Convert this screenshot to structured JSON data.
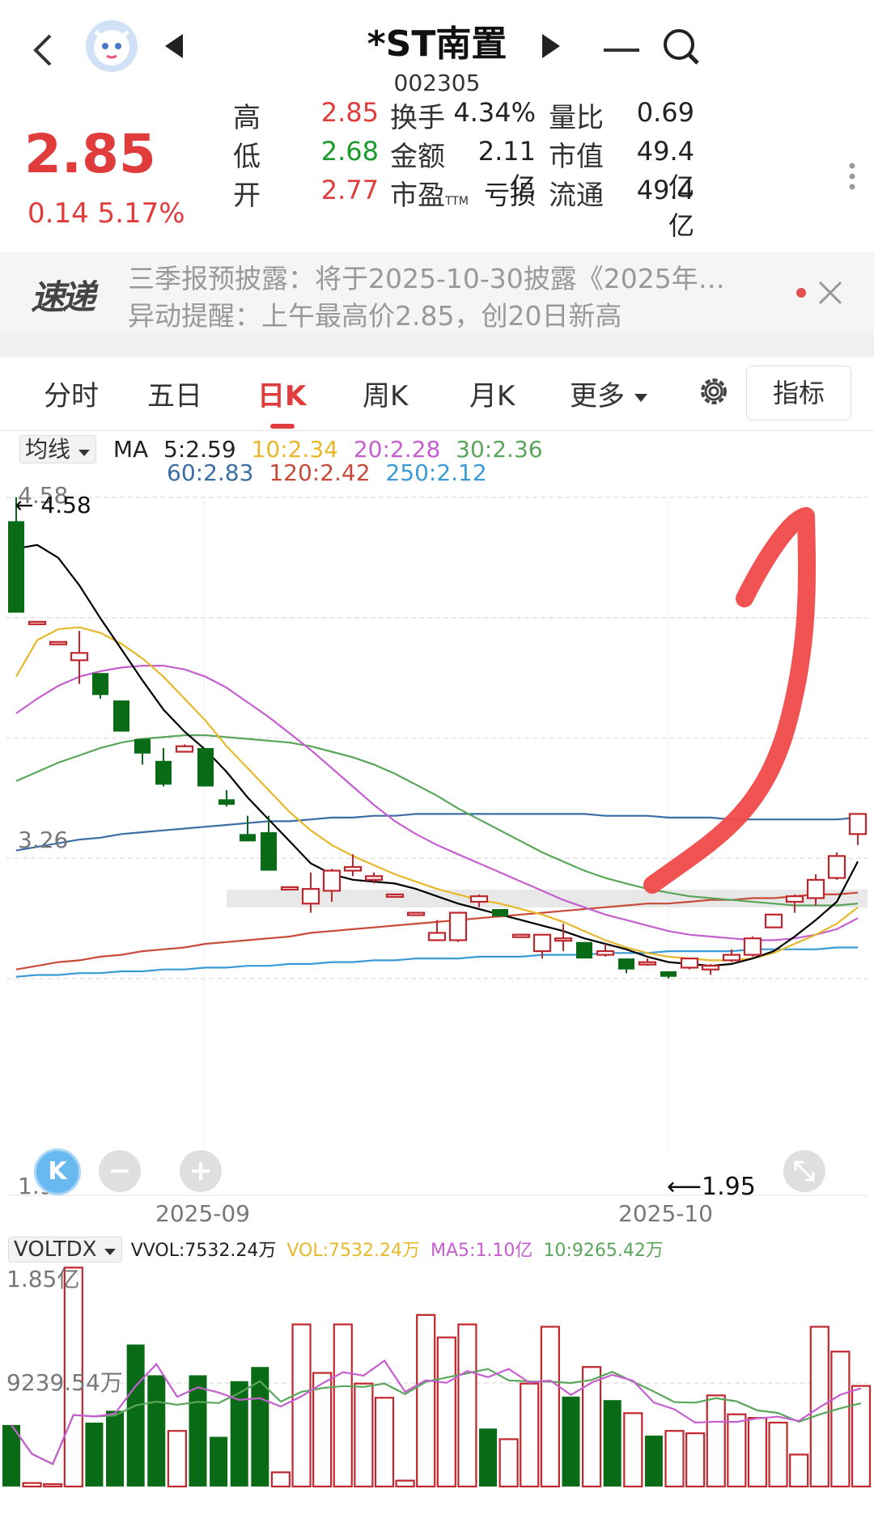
{
  "header": {
    "title": "*ST南置",
    "code": "002305"
  },
  "quote": {
    "price": "2.85",
    "change": "0.14",
    "change_pct": "5.17%",
    "rows": [
      {
        "l1": "高",
        "v1": "2.85",
        "c1": "red",
        "l2": "换手",
        "v2": "4.34%",
        "l3": "量比",
        "v3": "0.69"
      },
      {
        "l1": "低",
        "v1": "2.68",
        "c1": "green",
        "l2": "金额",
        "v2": "2.11亿",
        "l3": "市值",
        "v3": "49.4亿"
      },
      {
        "l1": "开",
        "v1": "2.77",
        "c1": "red",
        "l2": "市盈",
        "l2sub": "TTM",
        "v2": "亏损",
        "l3": "流通",
        "v3": "49.4亿"
      }
    ]
  },
  "news": {
    "logo": "速递",
    "line1": "三季报预披露：将于2025-10-30披露《2025年…",
    "line2": "异动提醒：上午最高价2.85，创20日新高"
  },
  "tabs": [
    "分时",
    "五日",
    "日K",
    "周K",
    "月K",
    "更多"
  ],
  "active_tab": "日K",
  "indicator_button": "指标",
  "ma": {
    "selector": "均线",
    "label": "MA",
    "ma5": "5:2.59",
    "ma10": "10:2.34",
    "ma20": "20:2.28",
    "ma30": "30:2.36",
    "ma60": "60:2.83",
    "ma120": "120:2.42",
    "ma250": "250:2.12"
  },
  "price_axis": {
    "top": "4.58",
    "mid": "3.26",
    "bottom": "1.95"
  },
  "annotations": {
    "high": "4.58",
    "low": "1.95"
  },
  "date_axis": [
    "2025-09",
    "2025-10"
  ],
  "volume": {
    "selector": "VOLTDX",
    "vvol": "VVOL:7532.24万",
    "vol": "VOL:7532.24万",
    "ma5": "MA5:1.10亿",
    "ma10": "10:9265.42万",
    "axis_top": "1.85亿",
    "axis_mid": "9239.54万"
  },
  "colors": {
    "up": "#c0262d",
    "down": "#0a6b16",
    "ma5": "#000000",
    "ma10": "#e6b82a",
    "ma20": "#c55fd0",
    "ma30": "#5aa65a",
    "ma60": "#3a6ea5",
    "ma120": "#c94a3a",
    "ma250": "#3a9ad6"
  },
  "chart_data": {
    "type": "candlestick",
    "candles": [
      {
        "o": 4.45,
        "c": 3.95,
        "h": 4.58,
        "l": 3.95
      },
      {
        "o": 3.9,
        "c": 3.9,
        "h": 3.9,
        "l": 3.9
      },
      {
        "o": 3.79,
        "c": 3.79,
        "h": 3.79,
        "l": 3.79
      },
      {
        "o": 3.69,
        "c": 3.73,
        "h": 3.85,
        "l": 3.56
      },
      {
        "o": 3.62,
        "c": 3.5,
        "h": 3.62,
        "l": 3.48
      },
      {
        "o": 3.47,
        "c": 3.3,
        "h": 3.47,
        "l": 3.3
      },
      {
        "o": 3.26,
        "c": 3.18,
        "h": 3.26,
        "l": 3.12
      },
      {
        "o": 3.14,
        "c": 3.01,
        "h": 3.21,
        "l": 3.0
      },
      {
        "o": 3.19,
        "c": 3.22,
        "h": 3.23,
        "l": 3.19
      },
      {
        "o": 3.21,
        "c": 3.0,
        "h": 3.21,
        "l": 3.0
      },
      {
        "o": 2.93,
        "c": 2.9,
        "h": 2.98,
        "l": 2.89
      },
      {
        "o": 2.74,
        "c": 2.7,
        "h": 2.84,
        "l": 2.7
      },
      {
        "o": 2.75,
        "c": 2.54,
        "h": 2.84,
        "l": 2.54
      },
      {
        "o": 2.45,
        "c": 2.45,
        "h": 2.45,
        "l": 2.45
      },
      {
        "o": 2.36,
        "c": 2.44,
        "h": 2.53,
        "l": 2.31
      },
      {
        "o": 2.43,
        "c": 2.54,
        "h": 2.55,
        "l": 2.37
      },
      {
        "o": 2.54,
        "c": 2.56,
        "h": 2.63,
        "l": 2.51
      },
      {
        "o": 2.49,
        "c": 2.51,
        "h": 2.53,
        "l": 2.47
      },
      {
        "o": 2.41,
        "c": 2.41,
        "h": 2.41,
        "l": 2.41
      },
      {
        "o": 2.31,
        "c": 2.31,
        "h": 2.31,
        "l": 2.31
      },
      {
        "o": 2.16,
        "c": 2.2,
        "h": 2.27,
        "l": 2.16
      },
      {
        "o": 2.16,
        "c": 2.31,
        "h": 2.31,
        "l": 2.15
      },
      {
        "o": 2.37,
        "c": 2.4,
        "h": 2.41,
        "l": 2.34
      },
      {
        "o": 2.33,
        "c": 2.29,
        "h": 2.33,
        "l": 2.29
      },
      {
        "o": 2.19,
        "c": 2.19,
        "h": 2.19,
        "l": 2.19
      },
      {
        "o": 2.1,
        "c": 2.19,
        "h": 2.19,
        "l": 2.06
      },
      {
        "o": 2.17,
        "c": 2.17,
        "h": 2.25,
        "l": 2.1
      },
      {
        "o": 2.15,
        "c": 2.06,
        "h": 2.15,
        "l": 2.06
      },
      {
        "o": 2.08,
        "c": 2.1,
        "h": 2.14,
        "l": 2.07
      },
      {
        "o": 2.06,
        "c": 2.0,
        "h": 2.06,
        "l": 1.98
      },
      {
        "o": 2.04,
        "c": 2.04,
        "h": 2.06,
        "l": 2.02
      },
      {
        "o": 1.99,
        "c": 1.96,
        "h": 1.99,
        "l": 1.95
      },
      {
        "o": 2.01,
        "c": 2.06,
        "h": 2.06,
        "l": 2.0
      },
      {
        "o": 2.0,
        "c": 2.02,
        "h": 2.03,
        "l": 1.97
      },
      {
        "o": 2.05,
        "c": 2.08,
        "h": 2.11,
        "l": 2.04
      },
      {
        "o": 2.08,
        "c": 2.17,
        "h": 2.18,
        "l": 2.07
      },
      {
        "o": 2.23,
        "c": 2.3,
        "h": 2.3,
        "l": 2.23
      },
      {
        "o": 2.37,
        "c": 2.4,
        "h": 2.41,
        "l": 2.31
      },
      {
        "o": 2.39,
        "c": 2.49,
        "h": 2.52,
        "l": 2.35
      },
      {
        "o": 2.5,
        "c": 2.62,
        "h": 2.64,
        "l": 2.49
      },
      {
        "o": 2.74,
        "c": 2.85,
        "h": 2.85,
        "l": 2.68
      }
    ],
    "ma5": [
      4.3,
      4.32,
      4.25,
      4.1,
      3.92,
      3.75,
      3.58,
      3.42,
      3.3,
      3.2,
      3.08,
      2.94,
      2.82,
      2.7,
      2.58,
      2.52,
      2.49,
      2.48,
      2.47,
      2.44,
      2.4,
      2.36,
      2.33,
      2.3,
      2.27,
      2.24,
      2.21,
      2.17,
      2.14,
      2.11,
      2.07,
      2.04,
      2.03,
      2.02,
      2.03,
      2.06,
      2.1,
      2.18,
      2.27,
      2.37,
      2.59
    ],
    "ma10": [
      3.6,
      3.8,
      3.86,
      3.87,
      3.84,
      3.78,
      3.7,
      3.6,
      3.48,
      3.36,
      3.22,
      3.1,
      2.98,
      2.86,
      2.76,
      2.68,
      2.62,
      2.57,
      2.52,
      2.48,
      2.44,
      2.41,
      2.38,
      2.36,
      2.33,
      2.3,
      2.26,
      2.21,
      2.16,
      2.12,
      2.09,
      2.07,
      2.06,
      2.05,
      2.05,
      2.06,
      2.09,
      2.14,
      2.19,
      2.25,
      2.34
    ],
    "ma20": [
      3.4,
      3.48,
      3.55,
      3.6,
      3.63,
      3.65,
      3.66,
      3.66,
      3.64,
      3.6,
      3.54,
      3.46,
      3.38,
      3.29,
      3.2,
      3.1,
      3.0,
      2.9,
      2.81,
      2.74,
      2.68,
      2.63,
      2.58,
      2.53,
      2.48,
      2.43,
      2.38,
      2.34,
      2.3,
      2.27,
      2.24,
      2.21,
      2.19,
      2.18,
      2.17,
      2.16,
      2.16,
      2.17,
      2.19,
      2.22,
      2.28
    ],
    "ma30": [
      3.03,
      3.08,
      3.13,
      3.17,
      3.21,
      3.24,
      3.26,
      3.27,
      3.28,
      3.28,
      3.27,
      3.26,
      3.25,
      3.24,
      3.22,
      3.19,
      3.16,
      3.12,
      3.07,
      3.01,
      2.95,
      2.88,
      2.82,
      2.76,
      2.7,
      2.64,
      2.59,
      2.54,
      2.5,
      2.47,
      2.44,
      2.42,
      2.4,
      2.39,
      2.38,
      2.37,
      2.36,
      2.35,
      2.35,
      2.35,
      2.36
    ],
    "ma60": [
      2.65,
      2.67,
      2.69,
      2.71,
      2.72,
      2.74,
      2.75,
      2.76,
      2.77,
      2.78,
      2.79,
      2.8,
      2.81,
      2.81,
      2.82,
      2.83,
      2.83,
      2.84,
      2.84,
      2.85,
      2.85,
      2.85,
      2.85,
      2.85,
      2.85,
      2.85,
      2.85,
      2.85,
      2.84,
      2.84,
      2.84,
      2.83,
      2.83,
      2.83,
      2.82,
      2.82,
      2.82,
      2.82,
      2.82,
      2.82,
      2.83
    ],
    "ma120": [
      2.0,
      2.02,
      2.04,
      2.05,
      2.07,
      2.08,
      2.1,
      2.11,
      2.12,
      2.14,
      2.15,
      2.16,
      2.17,
      2.18,
      2.2,
      2.21,
      2.22,
      2.23,
      2.24,
      2.25,
      2.26,
      2.27,
      2.28,
      2.29,
      2.3,
      2.31,
      2.32,
      2.33,
      2.34,
      2.35,
      2.36,
      2.36,
      2.37,
      2.38,
      2.38,
      2.39,
      2.39,
      2.4,
      2.41,
      2.41,
      2.42
    ],
    "ma250": [
      1.96,
      1.97,
      1.97,
      1.98,
      1.98,
      1.99,
      1.99,
      2.0,
      2.0,
      2.01,
      2.01,
      2.02,
      2.02,
      2.03,
      2.03,
      2.04,
      2.04,
      2.05,
      2.05,
      2.06,
      2.06,
      2.06,
      2.07,
      2.07,
      2.07,
      2.08,
      2.08,
      2.08,
      2.09,
      2.09,
      2.09,
      2.1,
      2.1,
      2.1,
      2.1,
      2.11,
      2.11,
      2.11,
      2.11,
      2.12,
      2.12
    ],
    "volumes": [
      0.52,
      0.03,
      0.02,
      1.85,
      0.54,
      0.64,
      1.2,
      0.94,
      0.47,
      0.94,
      0.42,
      0.89,
      1.01,
      0.12,
      1.37,
      0.96,
      1.37,
      0.87,
      0.75,
      0.05,
      1.45,
      1.26,
      1.37,
      0.49,
      0.4,
      0.87,
      1.35,
      0.76,
      1.01,
      0.73,
      0.62,
      0.43,
      0.47,
      0.45,
      0.77,
      0.61,
      0.58,
      0.54,
      0.27,
      1.35,
      1.14,
      0.85
    ],
    "vol_ylim": [
      0,
      1.9
    ]
  }
}
